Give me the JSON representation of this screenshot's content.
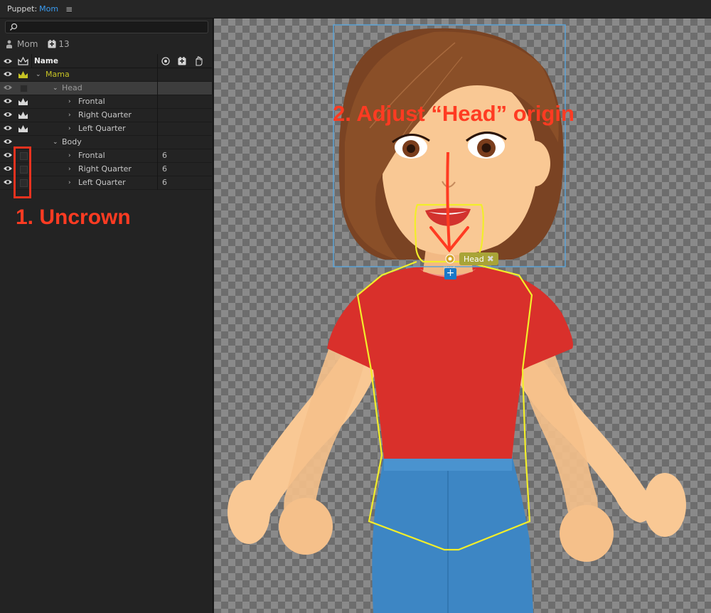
{
  "panel": {
    "title_prefix": "Puppet:",
    "title_name": "Mom",
    "menu_icon": "hamburger-icon",
    "search": {
      "placeholder": "",
      "value": ""
    },
    "puppet_name": "Mom",
    "item_count": "13",
    "columns": {
      "name": "Name"
    },
    "layers": [
      {
        "label": "Mama",
        "expanded": true,
        "crowned": true,
        "value": "",
        "color": "#c6c324"
      },
      {
        "label": "Head",
        "expanded": true,
        "crowned": false,
        "value": "",
        "selected": true
      },
      {
        "label": "Frontal",
        "expanded": false,
        "crowned": true,
        "value": ""
      },
      {
        "label": "Right Quarter",
        "expanded": false,
        "crowned": true,
        "value": ""
      },
      {
        "label": "Left Quarter",
        "expanded": false,
        "crowned": true,
        "value": ""
      },
      {
        "label": "Body",
        "expanded": true,
        "crowned": false,
        "value": ""
      },
      {
        "label": "Frontal",
        "expanded": false,
        "crowned": false,
        "value": "6"
      },
      {
        "label": "Right Quarter",
        "expanded": false,
        "crowned": false,
        "value": "6"
      },
      {
        "label": "Left Quarter",
        "expanded": false,
        "crowned": false,
        "value": "6"
      }
    ]
  },
  "annotations": {
    "step1": "1. Uncrown",
    "step2": "2. Adjust “Head” origin"
  },
  "canvas": {
    "head_tag": "Head",
    "head_tag_close": "✖",
    "plus_caption": "Head",
    "plus_label": "+"
  },
  "colors": {
    "accent": "#3a9bf0",
    "annotation": "#ff3b22",
    "crown": "#c6c324",
    "handle_outline": "#f2ee2a"
  }
}
